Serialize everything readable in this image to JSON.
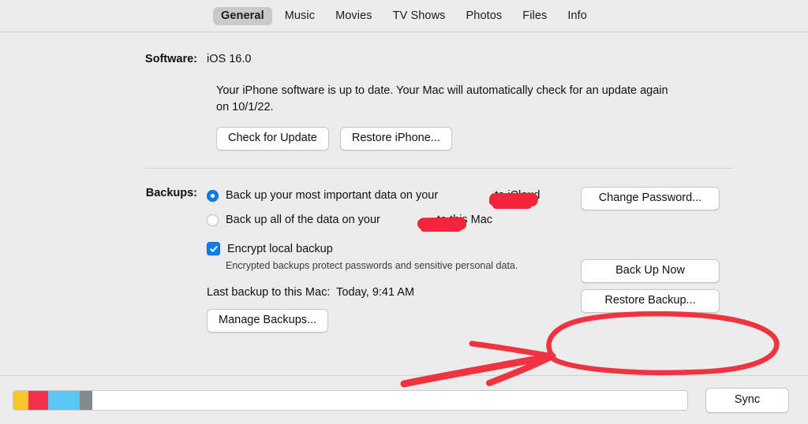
{
  "tabs": [
    {
      "label": "General",
      "selected": true
    },
    {
      "label": "Music",
      "selected": false
    },
    {
      "label": "Movies",
      "selected": false
    },
    {
      "label": "TV Shows",
      "selected": false
    },
    {
      "label": "Photos",
      "selected": false
    },
    {
      "label": "Files",
      "selected": false
    },
    {
      "label": "Info",
      "selected": false
    }
  ],
  "software": {
    "label": "Software:",
    "version": "iOS 16.0",
    "description": "Your iPhone software is up to date. Your Mac will automatically check for an update again on 10/1/22.",
    "check_update_label": "Check for Update",
    "restore_iphone_label": "Restore iPhone..."
  },
  "backups": {
    "label": "Backups:",
    "option_icloud": "Back up your most important data on your          to iCloud",
    "option_icloud_prefix": "Back up your most important data on your",
    "option_icloud_suffix": "to iCloud",
    "option_mac_prefix": "Back up all of the data on your",
    "option_mac_suffix": "to this Mac",
    "selected_option": "icloud",
    "encrypt_label": "Encrypt local backup",
    "encrypt_checked": true,
    "encrypt_note": "Encrypted backups protect passwords and sensitive personal data.",
    "change_password_label": "Change Password...",
    "last_backup_label": "Last backup to this Mac:",
    "last_backup_value": "Today, 9:41 AM",
    "manage_backups_label": "Manage Backups...",
    "back_up_now_label": "Back Up Now",
    "restore_backup_label": "Restore Backup..."
  },
  "bottom_bar": {
    "sync_label": "Sync",
    "capacity_segments": [
      {
        "name": "documents-data",
        "color": "#f6c62b",
        "width_pct": 2.2
      },
      {
        "name": "photos",
        "color": "#f5304e",
        "width_pct": 3.0
      },
      {
        "name": "media",
        "color": "#5ac8f5",
        "width_pct": 4.6
      },
      {
        "name": "other",
        "color": "#85898c",
        "width_pct": 1.9
      },
      {
        "name": "free-space",
        "color": "#ffffff",
        "width_pct": 88.3
      }
    ]
  },
  "annotations": {
    "highlight_color": "#ef3340",
    "circled_target": "Restore Backup...",
    "arrow_points_to": "Restore Backup..."
  },
  "colors": {
    "window_background": "#ececec",
    "accent_blue": "#0a7cf1",
    "annotation_red": "#ef3340",
    "redaction_red": "#f3243c"
  }
}
